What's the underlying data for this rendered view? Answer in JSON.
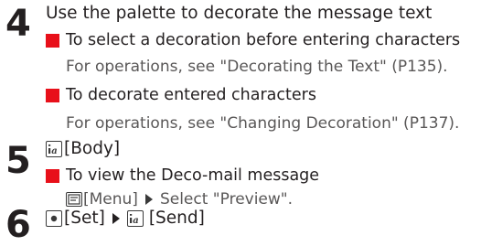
{
  "steps": [
    {
      "number": "4",
      "heading": "Use the palette to decorate the message text",
      "bullets": [
        {
          "title": "To select a decoration before entering characters",
          "detail": "For operations, see \"Decorating the Text\" (P135)."
        },
        {
          "title": "To decorate entered characters",
          "detail": "For operations, see \"Changing Decoration\" (P137)."
        }
      ]
    },
    {
      "number": "5",
      "heading": "[Body]",
      "heading_icon": "text-icon",
      "bullets": [
        {
          "title": "To view the Deco-mail message",
          "detail_key_icon": "menu-key-icon",
          "detail_key_label": "[Menu]",
          "detail_after_arrow": "Select \"Preview\"."
        }
      ]
    },
    {
      "number": "6",
      "key_icon": "center-key-icon",
      "key_label": "[Set]",
      "key2_icon": "text-icon",
      "key2_label": "[Send]"
    }
  ],
  "colors": {
    "bullet": "#e8101a",
    "text": "#231f20",
    "detail_text": "#595757"
  }
}
